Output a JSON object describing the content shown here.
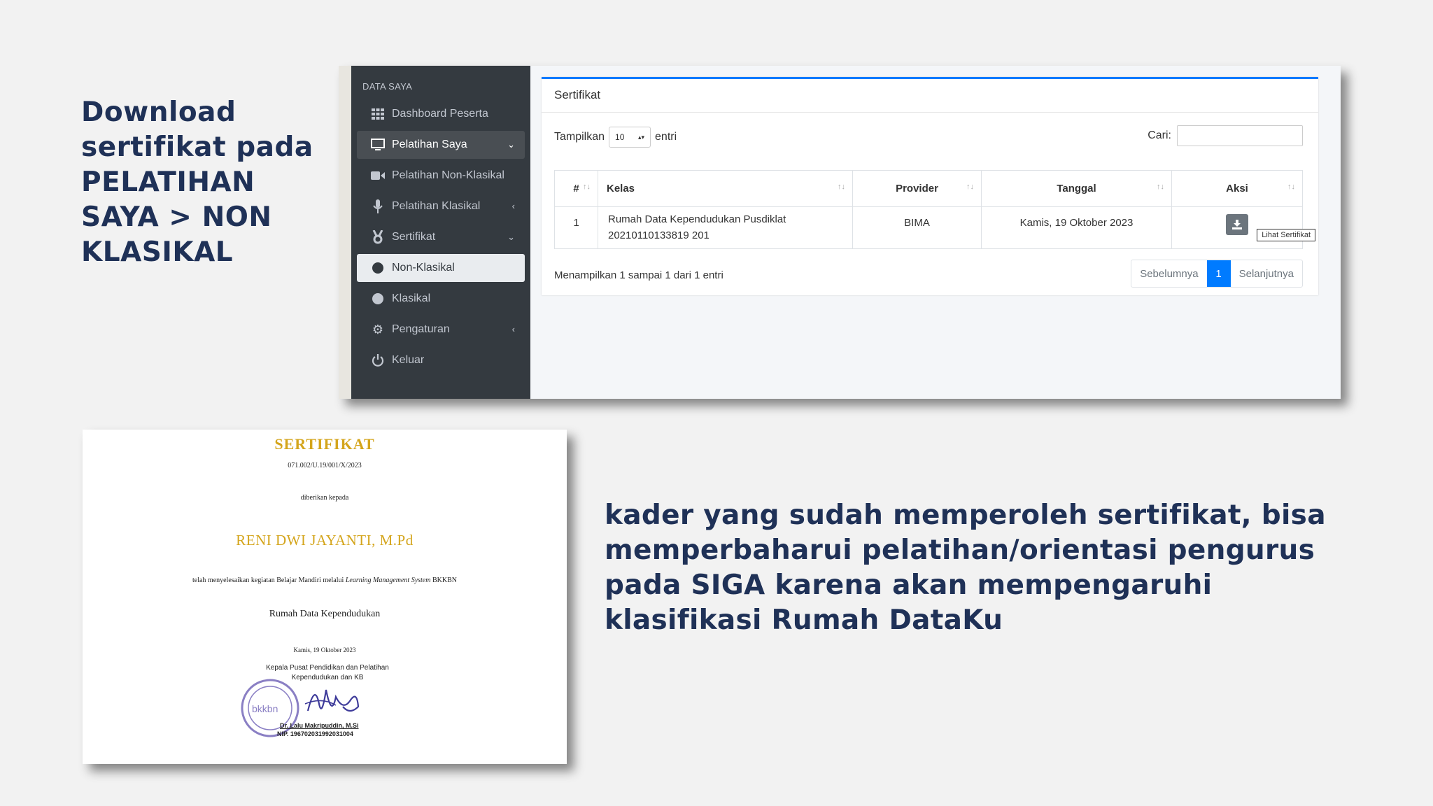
{
  "headline_top": "Download sertifikat pada PELATIHAN SAYA > NON KLASIKAL",
  "headline_bottom": "kader yang sudah memperoleh sertifikat, bisa memperbaharui pelatihan/orientasi pengurus pada SIGA karena akan mempengaruhi klasifikasi Rumah DataKu",
  "colors": {
    "text_navy": "#1f3157",
    "sidebar_bg": "#343a40",
    "accent_blue": "#007bff",
    "cert_gold": "#d4a51c"
  },
  "sidebar": {
    "header": "DATA SAYA",
    "items": [
      {
        "label": "Dashboard Peserta",
        "icon": "grid-icon"
      },
      {
        "label": "Pelatihan Saya",
        "icon": "monitor-icon"
      },
      {
        "label": "Pelatihan Non-Klasikal",
        "icon": "video-icon"
      },
      {
        "label": "Pelatihan Klasikal",
        "icon": "microphone-icon"
      },
      {
        "label": "Sertifikat",
        "icon": "award-icon"
      },
      {
        "label": "Non-Klasikal",
        "icon": "circle-icon"
      },
      {
        "label": "Klasikal",
        "icon": "circle-icon"
      },
      {
        "label": "Pengaturan",
        "icon": "gear-icon"
      },
      {
        "label": "Keluar",
        "icon": "power-icon"
      }
    ]
  },
  "card": {
    "title": "Sertifikat",
    "show_label": "Tampilkan",
    "show_value": "10",
    "entries_label": "entri",
    "search_label": "Cari:",
    "search_value": "",
    "columns": [
      "#",
      "Kelas",
      "Provider",
      "Tanggal",
      "Aksi"
    ],
    "rows": [
      {
        "no": "1",
        "kelas_line1": "Rumah Data Kependudukan Pusdiklat",
        "kelas_line2": "20210110133819 201",
        "provider": "BIMA",
        "tanggal": "Kamis, 19 Oktober 2023"
      }
    ],
    "tooltip": "Lihat Sertifikat",
    "info": "Menampilkan 1 sampai 1 dari 1 entri",
    "pager": {
      "prev": "Sebelumnya",
      "current": "1",
      "next": "Selanjutnya"
    }
  },
  "certificate": {
    "title": "SERTIFIKAT",
    "number": "071.002/U.19/001/X/2023",
    "given_to": "diberikan kepada",
    "name": "RENI DWI JAYANTI, M.Pd",
    "desc_prefix": "telah menyelesaikan kegiatan Belajar Mandiri melalui ",
    "desc_italic": "Learning Management System",
    "desc_suffix": " BKKBN",
    "course": "Rumah Data Kependudukan",
    "date": "Kamis, 19 Oktober 2023",
    "signer_title": "Kepala Pusat Pendidikan dan Pelatihan Kependudukan dan KB",
    "stamp_text": "bkkbn",
    "signer_name": "Dr. Lalu Makripuddin, M.Si",
    "signer_nip": "NIP. 196702031992031004"
  }
}
